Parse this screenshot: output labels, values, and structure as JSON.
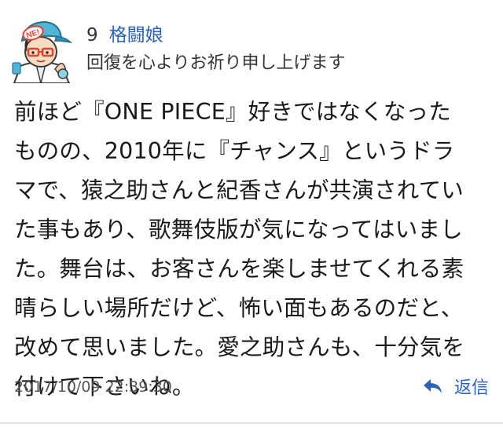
{
  "comment": {
    "number": "9",
    "author": "格闘娘",
    "subtitle": "回復を心よりお祈り申し上げます",
    "body": "前ほど『ONE PIECE』好きではなくなった\nものの、2010年に『チャンス』というドラ\nマで、猿之助さんと紀香さんが共演されてい\nた事もあり、歌舞伎版が気になってはいまし\nた。舞台は、お客さんを楽しませてくれる素\n晴らしい場所だけど、怖い面もあるのだと、\n改めて思いました。愛之助さんも、十分気を\n付けて下さいね。",
    "timestamp": "2017/10/09 22:39:30",
    "reply_label": "返信",
    "avatar_cap_text": "NE!"
  },
  "icons": {
    "avatar": "avatar-illustration",
    "reply": "reply-arrow-icon"
  },
  "colors": {
    "link_blue": "#2a62c0",
    "text": "#1a1a1a",
    "muted": "#555555",
    "cap_blue": "#4fb6d9",
    "cap_red": "#e8402f"
  }
}
